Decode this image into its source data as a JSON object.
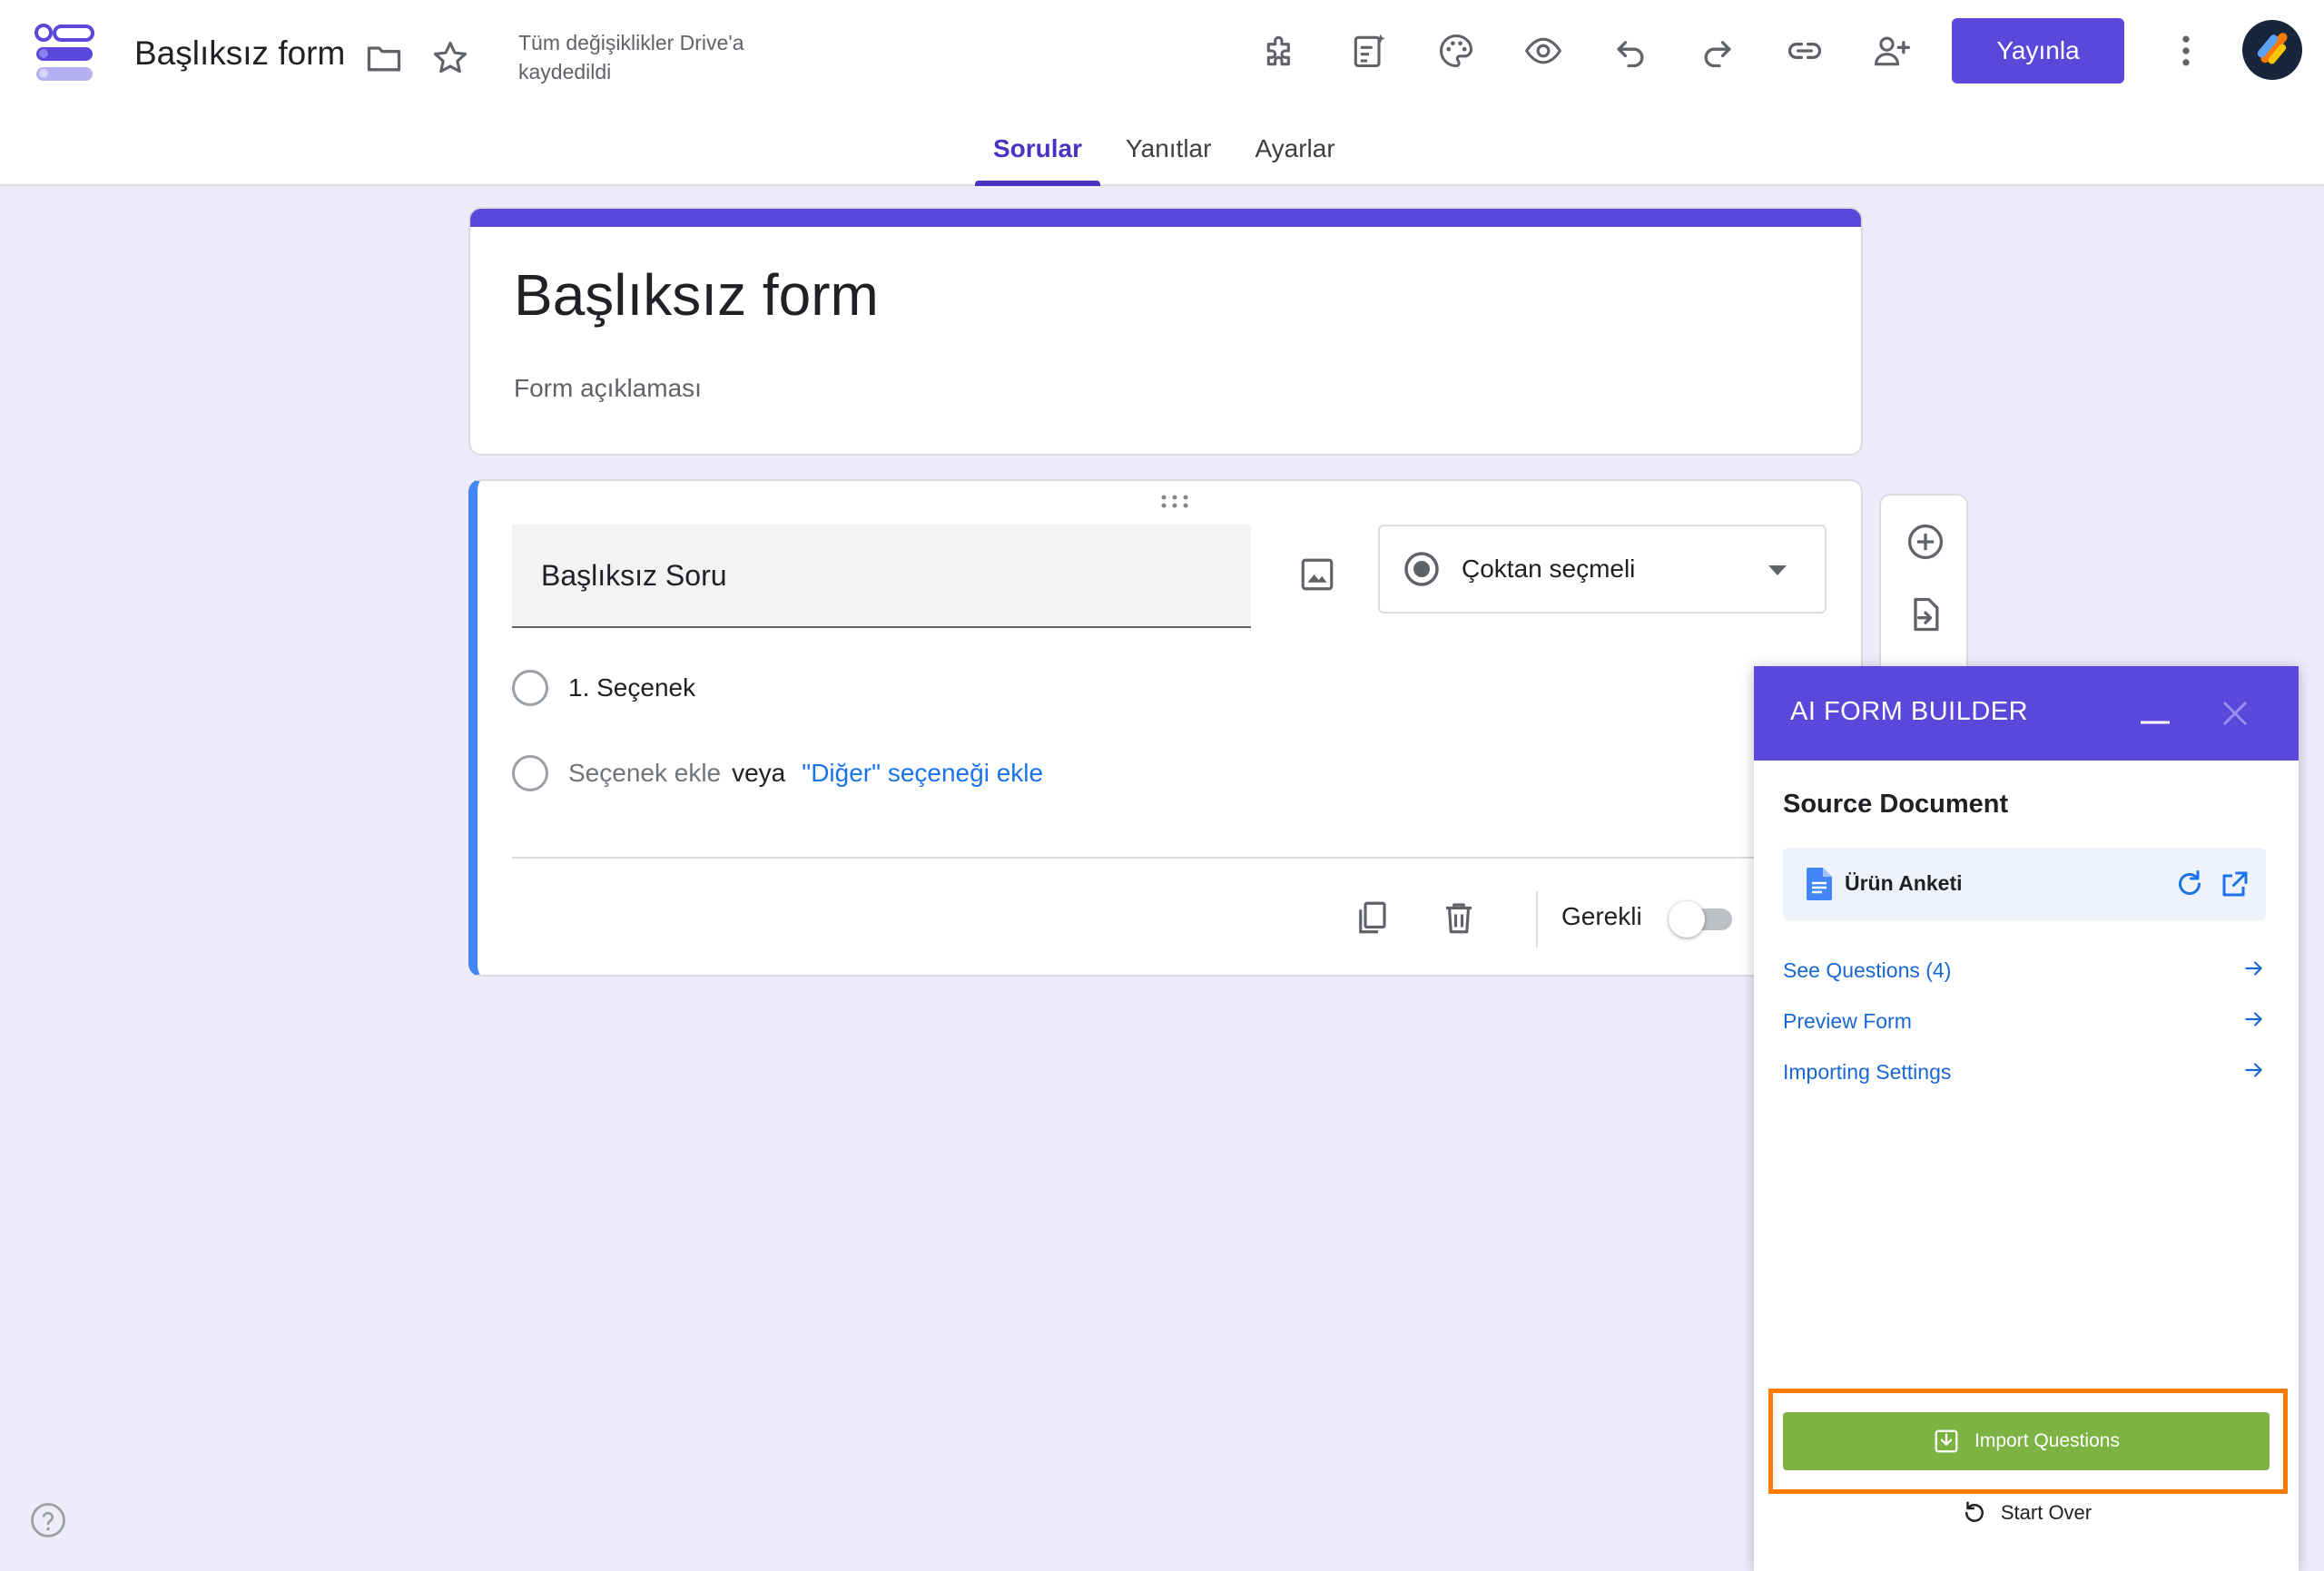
{
  "header": {
    "doc_title": "Başlıksız form",
    "save_status": "Tüm değişiklikler Drive'a kaydedildi",
    "publish_label": "Yayınla",
    "icons": [
      "folder-icon",
      "star-icon",
      "addon-icon",
      "ai-sparkle-icon",
      "palette-icon",
      "preview-icon",
      "undo-icon",
      "redo-icon",
      "link-icon",
      "add-collaborator-icon",
      "more-vert-icon"
    ]
  },
  "tabs": [
    {
      "label": "Sorular",
      "active": true
    },
    {
      "label": "Yanıtlar",
      "active": false
    },
    {
      "label": "Ayarlar",
      "active": false
    }
  ],
  "form": {
    "title": "Başlıksız form",
    "description_placeholder": "Form açıklaması"
  },
  "question": {
    "title": "Başlıksız Soru",
    "type": "Çoktan seçmeli",
    "option_1": "1. Seçenek",
    "add_option": "Seçenek ekle",
    "or": "veya",
    "add_other": "\"Diğer\" seçeneği ekle",
    "required_label": "Gerekli",
    "required": false
  },
  "ai_panel": {
    "title": "AI FORM BUILDER",
    "source_label": "Source Document",
    "document_name": "Ürün Anketi",
    "links": [
      "See Questions (4)",
      "Preview Form",
      "Importing Settings"
    ],
    "import_label": "Import Questions",
    "start_over_label": "Start Over"
  },
  "colors": {
    "accent": "#5b47d9",
    "question_border": "#4285f4",
    "import_green": "#7cb342",
    "highlight": "#ff7a00",
    "link": "#1967d2"
  }
}
